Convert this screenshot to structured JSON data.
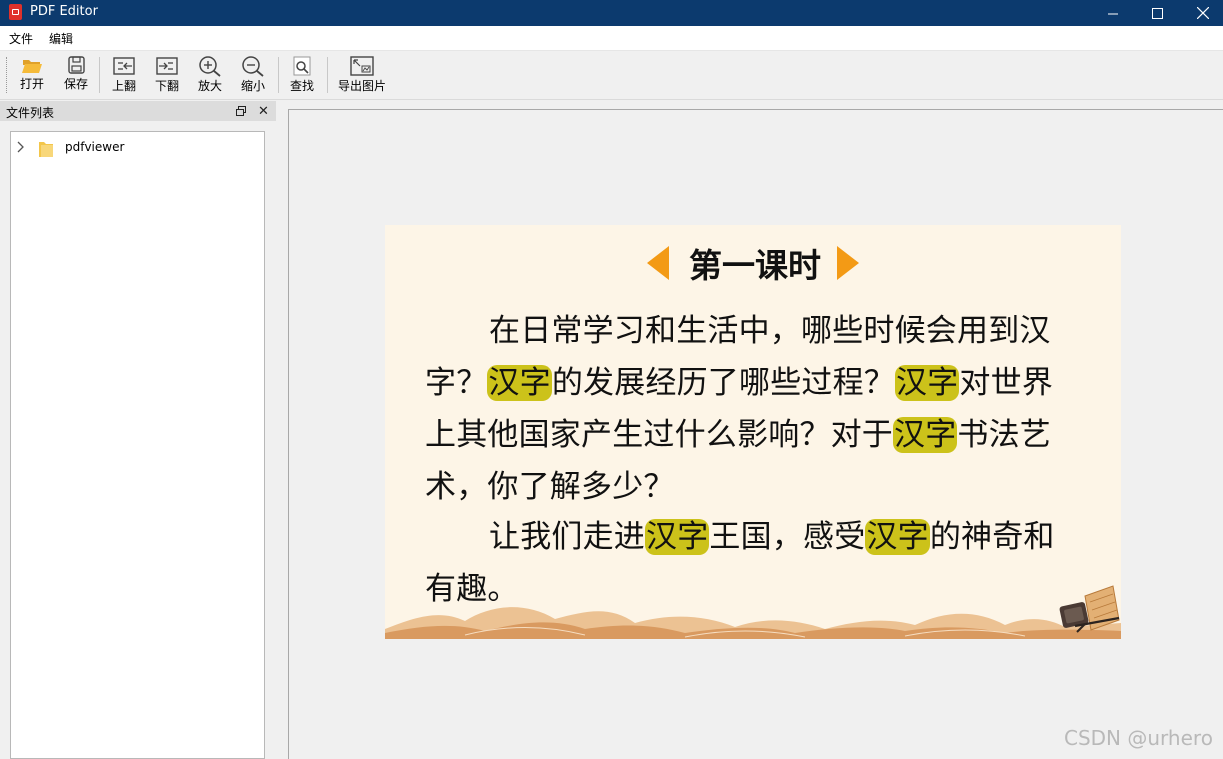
{
  "window": {
    "title": "PDF Editor"
  },
  "menu": {
    "items": [
      "文件",
      "编辑"
    ]
  },
  "toolbar": {
    "open": "打开",
    "save": "保存",
    "prev": "上翻",
    "next": "下翻",
    "zoom_in": "放大",
    "zoom_out": "缩小",
    "find": "查找",
    "export_image": "导出图片"
  },
  "dock": {
    "title": "文件列表",
    "tree": [
      {
        "label": "pdfviewer",
        "expanded": false
      }
    ]
  },
  "page": {
    "heading": "第一课时",
    "para1": [
      {
        "t": "在日常学习和生活中，哪些时候会用到汉字？"
      },
      {
        "t": "汉字",
        "hl": true
      },
      {
        "t": "的发展经历了哪些过程？"
      },
      {
        "t": "汉字",
        "hl": true
      },
      {
        "t": "对世界上其他国家产生过什么影响？对于"
      },
      {
        "t": "汉字",
        "hl": true
      },
      {
        "t": "书法艺术，你了解多少？"
      }
    ],
    "para2": [
      {
        "t": "让我们走进"
      },
      {
        "t": "汉字",
        "hl": true
      },
      {
        "t": "王国，感受"
      },
      {
        "t": "汉字",
        "hl": true
      },
      {
        "t": "的神奇和有趣。"
      }
    ],
    "highlight_color": "#ccc21a",
    "accent_color": "#f39a15",
    "background_color": "#fdf5e7"
  },
  "watermark": "CSDN @urhero",
  "colors": {
    "titlebar": "#0c3a6e"
  }
}
